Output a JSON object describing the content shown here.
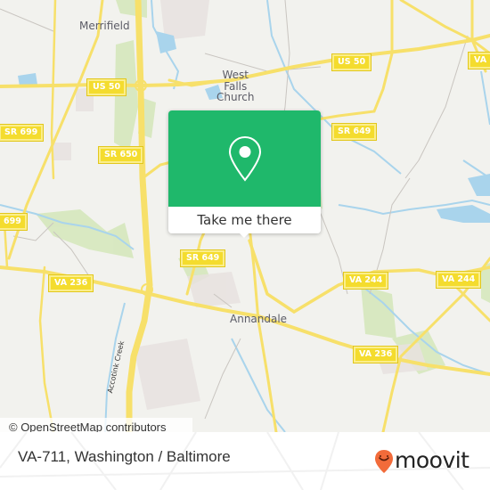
{
  "map": {
    "attribution": "© OpenStreetMap contributors",
    "places": [
      {
        "id": "merrifield",
        "label": "Merrifield"
      },
      {
        "id": "west-falls-church",
        "label": "West\nFalls\nChurch"
      },
      {
        "id": "annandale",
        "label": "Annandale"
      }
    ],
    "shields": [
      {
        "id": "us50-west",
        "label": "US 50"
      },
      {
        "id": "us50-east",
        "label": "US 50"
      },
      {
        "id": "va-ne",
        "label": "VA"
      },
      {
        "id": "sr699-top",
        "label": "SR 699"
      },
      {
        "id": "sr699-left",
        "label": "699"
      },
      {
        "id": "sr650",
        "label": "SR 650"
      },
      {
        "id": "sr649-ne",
        "label": "SR 649"
      },
      {
        "id": "sr649-center",
        "label": "SR 649"
      },
      {
        "id": "va236-west",
        "label": "VA 236"
      },
      {
        "id": "va236-east",
        "label": "VA 236"
      },
      {
        "id": "va244-center",
        "label": "VA 244"
      },
      {
        "id": "va244-east",
        "label": "VA 244"
      }
    ],
    "creek_label": "Accotink Creek",
    "colors": {
      "land": "#f2f2ee",
      "road": "#f7e06a",
      "water": "#a9d4ec",
      "park": "#d6e8bd",
      "urban": "#e8e2df"
    }
  },
  "popup": {
    "icon": "map-pin-icon",
    "action_label": "Take me there",
    "color": "#1fb86b"
  },
  "footer": {
    "location_title": "VA-711, Washington / Baltimore",
    "brand": "moovit",
    "brand_color": "#f26b3a"
  }
}
